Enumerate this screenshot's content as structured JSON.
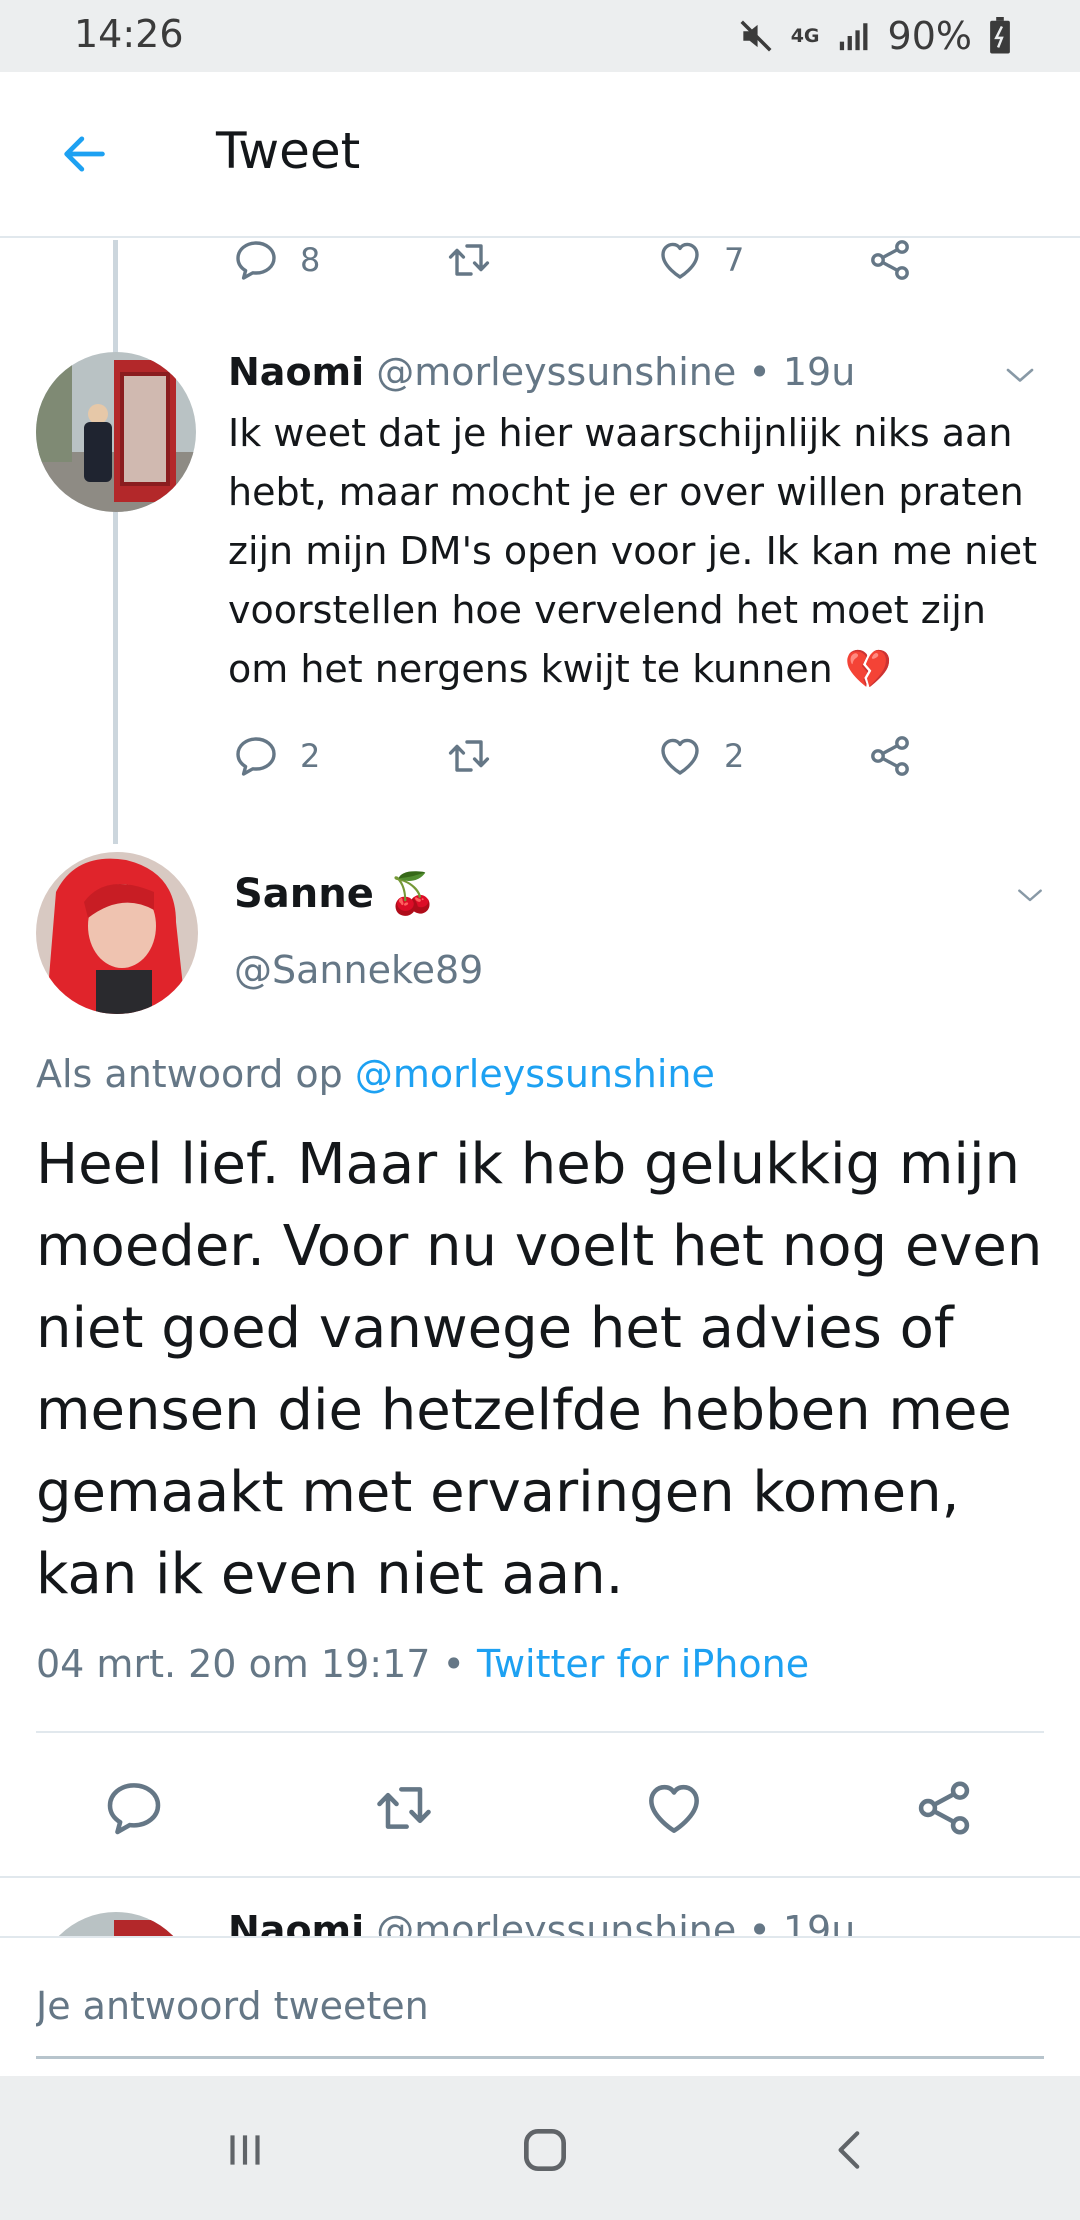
{
  "status_bar": {
    "time": "14:26",
    "network_type": "4G",
    "battery_percent": "90%"
  },
  "header": {
    "title": "Tweet"
  },
  "previous_tweet_actions": {
    "reply_count": "8",
    "retweet_count": "",
    "like_count": "7"
  },
  "reply_tweet": {
    "name": "Naomi",
    "handle": "@morleyssunshine",
    "time": "19u",
    "text": "Ik weet dat je hier waarschijnlijk niks aan hebt, maar mocht je er over willen praten zijn mijn DM's open voor je. Ik kan me niet voorstellen hoe vervelend het moet zijn om het nergens kwijt te kunnen 💔",
    "reply_count": "2",
    "like_count": "2"
  },
  "focused_tweet": {
    "name": "Sanne",
    "name_emoji": "🍒",
    "handle": "@Sanneke89",
    "reply_prefix": "Als antwoord op",
    "reply_to": "@morleyssunshine",
    "text": "Heel lief. Maar ik heb gelukkig mijn moeder. Voor nu voelt het nog even niet goed vanwege het advies of mensen die hetzelfde hebben mee gemaakt met ervaringen komen, kan ik even niet aan.",
    "timestamp": "04 mrt. 20 om 19:17",
    "source": "Twitter for iPhone"
  },
  "next_tweet": {
    "name": "Naomi",
    "handle": "@morleyssunshine",
    "time": "19u"
  },
  "composer": {
    "placeholder": "Je antwoord tweeten"
  },
  "colors": {
    "accent": "#1da1f2",
    "muted": "#657786",
    "divider": "#e1e8ed",
    "heart_broken": "#e0245e"
  },
  "icons": [
    "back-arrow-icon",
    "reply-icon",
    "retweet-icon",
    "like-icon",
    "share-icon",
    "chevron-down-icon",
    "mute-icon",
    "signal-icon",
    "battery-icon",
    "recent-apps-icon",
    "home-icon",
    "back-icon"
  ]
}
